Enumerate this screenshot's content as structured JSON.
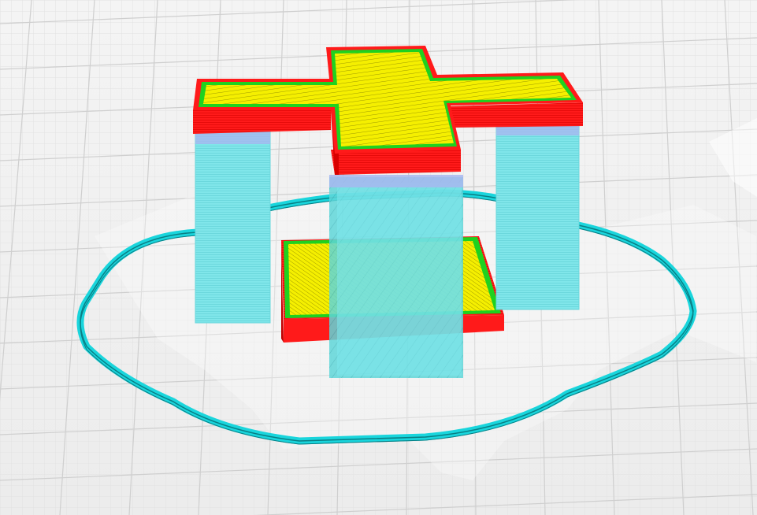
{
  "viewport": {
    "name": "3d-print-preview",
    "colors": {
      "background": "#f2f2f2",
      "grid_minor": "#e2e2e2",
      "grid_major": "#cfcfcf",
      "top_skin": "#f5ef00",
      "top_skin_line": "#8a8600",
      "wall_outer": "#ff1a1a",
      "wall_outer_dark": "#e00000",
      "wall_inner": "#1fd11f",
      "support": "#7ee8ec",
      "support_dark": "#5ccfd4",
      "support_interface": "#a8b8f0",
      "skirt": "#19d5dc",
      "skirt_dark": "#0a8a90",
      "shadow": "#ffffff"
    },
    "objects": [
      {
        "id": "cross-top",
        "kind": "model",
        "icon": "cross-shape"
      },
      {
        "id": "plate-bottom",
        "kind": "model",
        "icon": "rectangle-shape"
      },
      {
        "id": "support-left",
        "kind": "support"
      },
      {
        "id": "support-right",
        "kind": "support"
      },
      {
        "id": "support-center",
        "kind": "support"
      },
      {
        "id": "skirt-outline",
        "kind": "skirt"
      }
    ]
  }
}
